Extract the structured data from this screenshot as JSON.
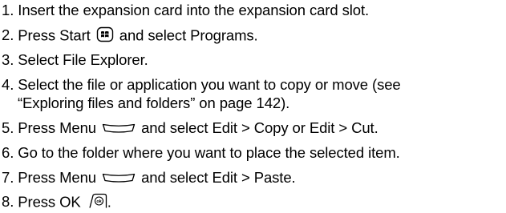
{
  "steps": [
    {
      "num": "1.",
      "text": "Insert the expansion card into the expansion card slot."
    },
    {
      "num": "2.",
      "text_before": "Press Start",
      "icon": "start-key-icon",
      "text_after": "and select Programs."
    },
    {
      "num": "3.",
      "text": "Select File Explorer."
    },
    {
      "num": "4.",
      "line1": "Select the file or application you want to copy or move (see",
      "line2": "“Exploring files and folders” on page 142)."
    },
    {
      "num": "5.",
      "text_before": "Press Menu",
      "icon": "menu-softkey-icon",
      "text_after": "and select Edit > Copy or Edit > Cut."
    },
    {
      "num": "6.",
      "text": "Go to the folder where you want to place the selected item."
    },
    {
      "num": "7.",
      "text_before": "Press Menu",
      "icon": "menu-softkey-icon",
      "text_after": "and select Edit > Paste."
    },
    {
      "num": "8.",
      "text_before": "Press OK",
      "icon": "ok-key-icon",
      "text_after": "."
    }
  ]
}
